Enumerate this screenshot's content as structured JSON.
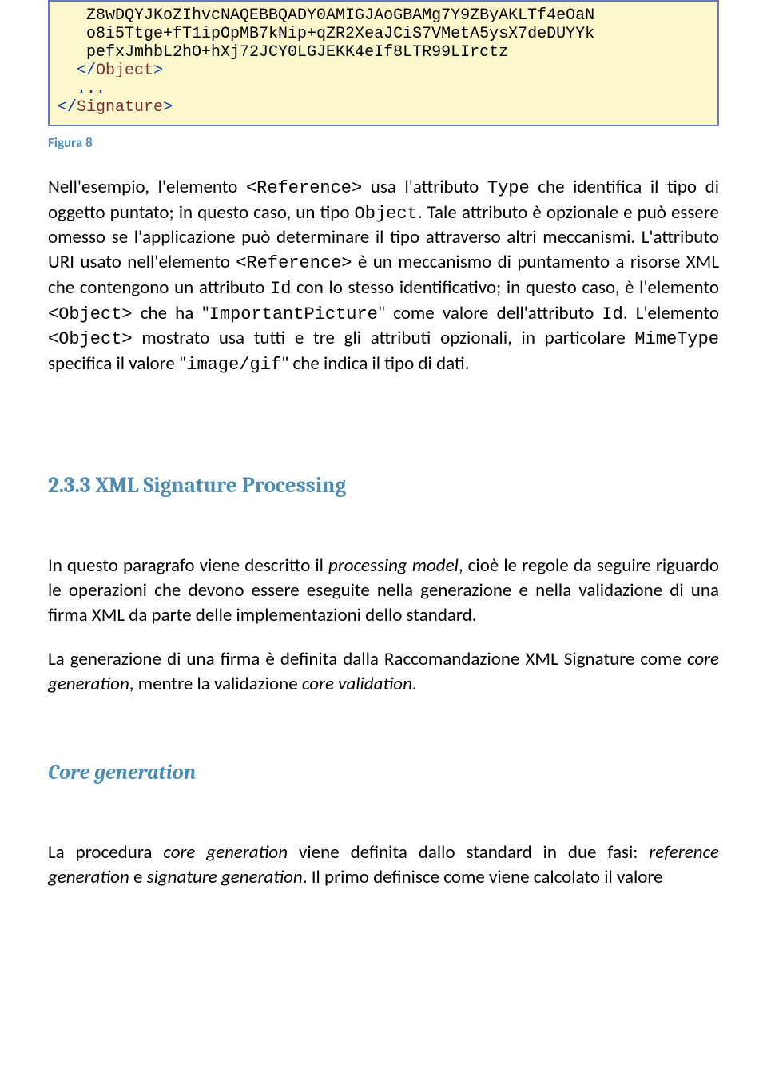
{
  "code": {
    "line1": "   Z8wDQYJKoZIhvcNAQEBBQADY0AMIGJAoGBAMg7Y9ZByAKLTf4eOaN",
    "line2": "   o8i5Ttge+fT1ipOpMB7kNip+qZR2XeaJCiS7VMetA5ysX7deDUYYk",
    "line3": "   pefxJmhbL2hO+hXj72JCY0LGJEKK4eIf8LTR99LIrctz",
    "line4a": "  </",
    "line4b": "Object",
    "line4c": ">",
    "line5": "  ...",
    "line6a": "</",
    "line6b": "Signature",
    "line6c": ">"
  },
  "figCaption": "Figura 8",
  "para1": {
    "t1": "Nell'esempio, l'elemento ",
    "c1": "<Reference>",
    "t2": " usa l'attributo ",
    "c2": "Type",
    "t3": " che identifica il tipo di oggetto puntato; in questo caso, un tipo ",
    "c3": "Object",
    "t4": ". Tale attributo è opzionale e può essere omesso se l'applicazione può determinare il tipo attraverso altri meccanismi. L'attributo URI usato nell'elemento ",
    "c4": "<Reference>",
    "t5": " è un meccanismo di puntamento a risorse XML che contengono un attributo ",
    "c5": "Id",
    "t6": " con lo stesso identificativo; in questo caso, è l'elemento ",
    "c6": "<Object>",
    "t7": " che ha \"",
    "c7": "ImportantPicture",
    "t8": "\" come valore dell'attributo ",
    "c8": "Id",
    "t9": ". L'elemento ",
    "c9": "<Object>",
    "t10": " mostrato usa tutti e tre gli attributi opzionali, in particolare ",
    "c10": "MimeType",
    "t11": " specifica il valore \"",
    "c11": "image/gif",
    "t12": "\" che indica il tipo di dati."
  },
  "heading1": "2.3.3 XML Signature Processing",
  "para2": {
    "t1": "In questo paragrafo viene descritto il ",
    "i1": "processing model",
    "t2": ", cioè le regole da seguire riguardo le operazioni che devono essere eseguite nella generazione e nella validazione di una firma XML da parte delle implementazioni dello standard."
  },
  "para3": {
    "t1": "La generazione di una firma è definita dalla Raccomandazione XML Signature come ",
    "i1": "core generation",
    "t2": ", mentre la validazione ",
    "i2": "core validation",
    "t3": "."
  },
  "heading2": "Core generation",
  "para4": {
    "t1": "La procedura ",
    "i1": "core generation",
    "t2": " viene definita dallo standard in due fasi: ",
    "i2": "reference generation",
    "t3": " e ",
    "i3": "signature generation",
    "t4": ". Il primo definisce come viene calcolato il valore"
  }
}
